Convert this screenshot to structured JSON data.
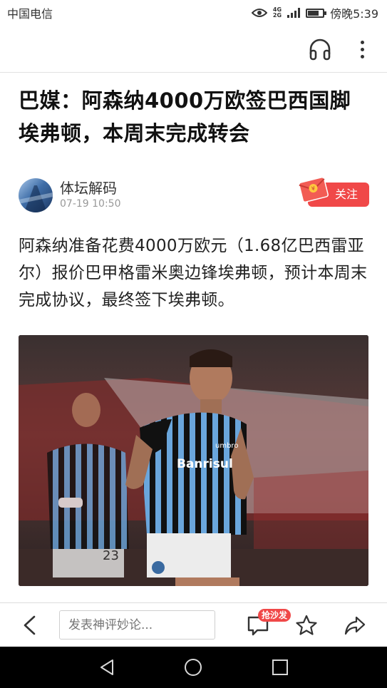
{
  "status_bar": {
    "carrier": "中国电信",
    "network_top": "4G",
    "network_bottom": "2G",
    "time": "傍晚5:39",
    "battery_level": 0.75
  },
  "toolbar": {
    "listen_icon": "headphones-icon",
    "more_icon": "more-vertical-icon"
  },
  "article": {
    "title": "巴媒：阿森纳4000万欧签巴西国脚埃弗顿，本周末完成转会",
    "author": {
      "name": "体坛解码",
      "time": "07-19 10:50",
      "follow_label": "关注"
    },
    "body": "阿森纳准备花费4000万欧元（1.68亿巴西雷亚尔）报价巴甲格雷米奥边锋埃弗顿，预计本周末完成协议，最终签下埃弗顿。",
    "photo": {
      "sponsor_text": "Banrisul",
      "jersey_brand": "umbro",
      "number": "23"
    }
  },
  "comment_bar": {
    "input_placeholder": "发表神评妙论...",
    "sofa_badge": "抢沙发",
    "icons": [
      "back-arrow-icon",
      "comment-icon",
      "star-icon",
      "share-icon"
    ]
  },
  "nav_bar": {
    "icons": [
      "nav-back-icon",
      "nav-home-icon",
      "nav-recent-icon"
    ]
  },
  "colors": {
    "accent_red": "#f04848",
    "text_dark": "#111111",
    "text_muted": "#999999"
  }
}
